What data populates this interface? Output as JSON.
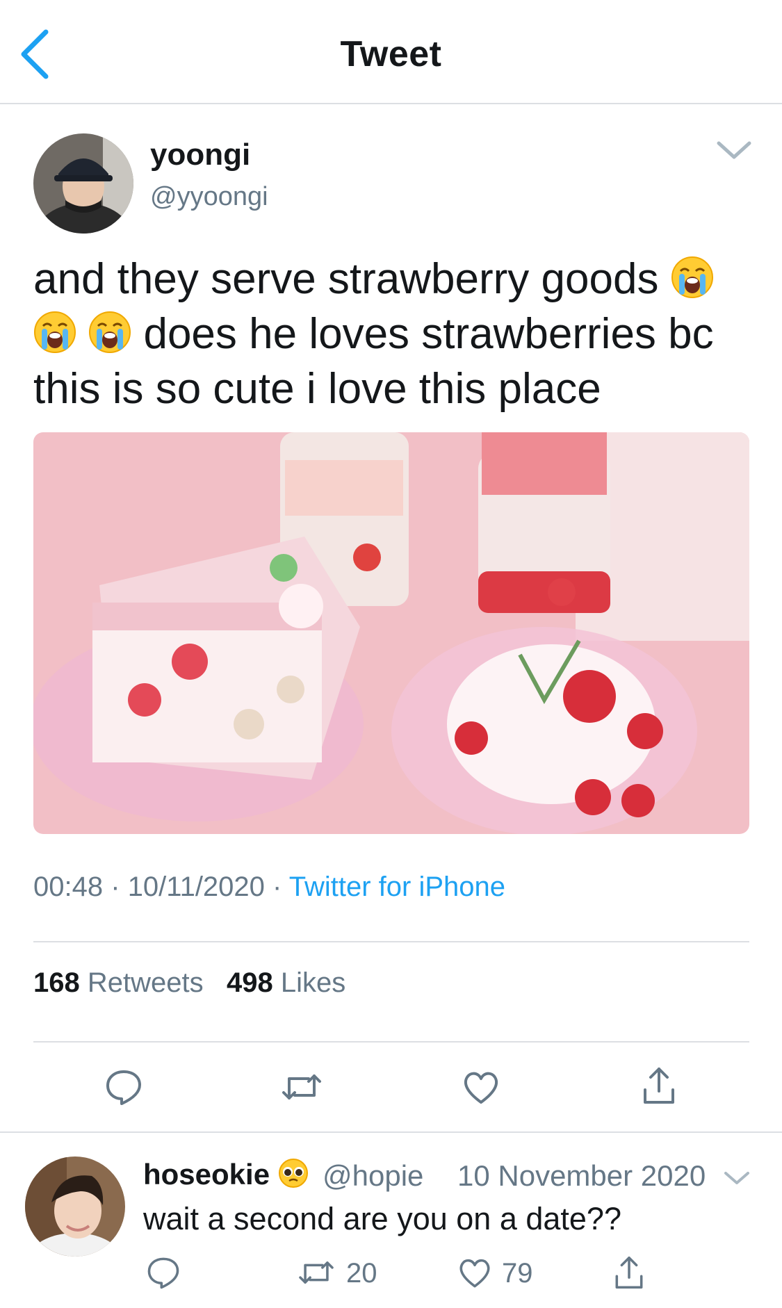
{
  "header": {
    "title": "Tweet"
  },
  "tweet": {
    "display_name": "yoongi",
    "handle": "@yyoongi",
    "text_parts": [
      "and they serve strawberry goods ",
      " does he loves strawberries bc this is so cute i love this place"
    ],
    "emoji": "loudly-crying-face",
    "time": "00:48",
    "date": "10/11/2020",
    "separator": "·",
    "source": "Twitter for iPhone",
    "retweets_count": "168",
    "retweets_label": "Retweets",
    "likes_count": "498",
    "likes_label": "Likes"
  },
  "reply": {
    "display_name": "hoseokie",
    "name_emoji": "pleading-face",
    "handle": "@hopie",
    "date": "10 November 2020",
    "text": "wait a second are you on a date??",
    "retweets": "20",
    "likes": "79"
  },
  "colors": {
    "accent": "#1da1f2",
    "secondary_text": "#657786",
    "divider": "#dcdfe3"
  }
}
